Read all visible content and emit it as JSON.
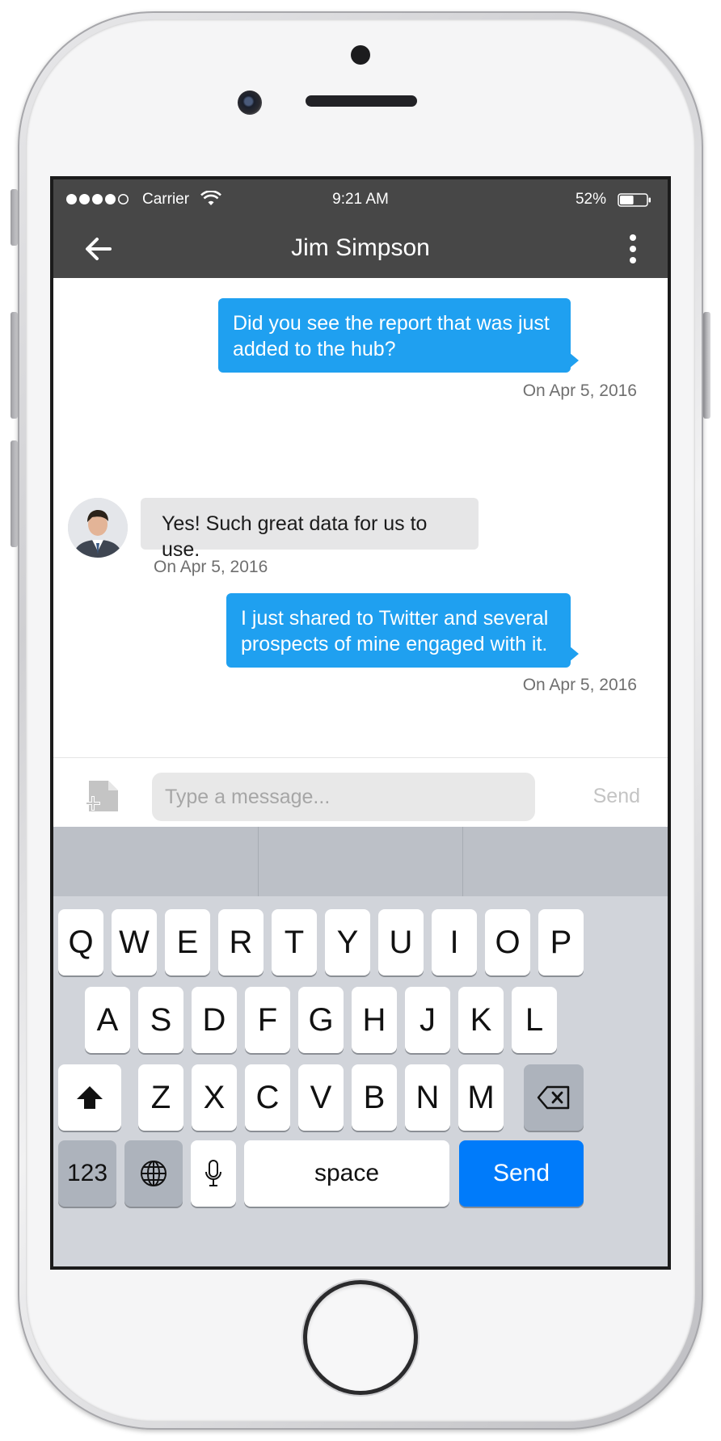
{
  "status_bar": {
    "carrier": "Carrier",
    "time": "9:21 AM",
    "battery": "52%",
    "battery_level": 0.52,
    "signal_bars": 4,
    "signal_total": 5
  },
  "nav": {
    "title": "Jim Simpson",
    "back_icon": "back-arrow-icon",
    "menu_icon": "more-vertical-icon"
  },
  "messages": [
    {
      "direction": "out",
      "text_line1": "Did you see the report that was just",
      "text_line2": "added to the hub?",
      "date": "On Apr 5, 2016"
    },
    {
      "direction": "in",
      "text": "Yes! Such great data for us to use.",
      "date": "On Apr 5, 2016"
    },
    {
      "direction": "out",
      "text_line1": "I just shared to Twitter and several",
      "text_line2": "prospects of mine engaged with it.",
      "date": "On Apr 5, 2016"
    }
  ],
  "composer": {
    "placeholder": "Type a message...",
    "send": "Send",
    "attach_icon": "add-file-icon"
  },
  "keyboard": {
    "row1": [
      "Q",
      "W",
      "E",
      "R",
      "T",
      "Y",
      "U",
      "I",
      "O",
      "P"
    ],
    "row2": [
      "A",
      "S",
      "D",
      "F",
      "G",
      "H",
      "J",
      "K",
      "L"
    ],
    "row3": [
      "Z",
      "X",
      "C",
      "V",
      "B",
      "N",
      "M"
    ],
    "numbers": "123",
    "space": "space",
    "send": "Send",
    "icons": [
      "shift-icon",
      "backspace-icon",
      "globe-icon",
      "microphone-icon"
    ]
  },
  "colors": {
    "bar": "#474747",
    "outgoing_bubble": "#1fa0f0",
    "incoming_bubble": "#e6e6e7",
    "send_key": "#007bfa"
  }
}
